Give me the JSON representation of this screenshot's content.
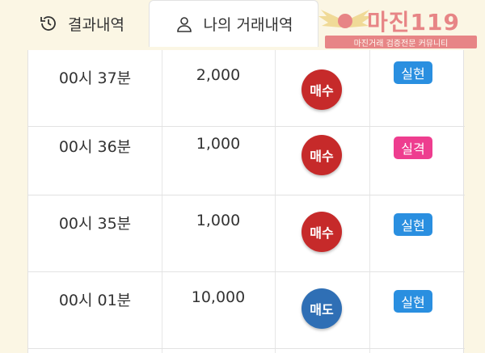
{
  "tabs": [
    {
      "label": "결과내역",
      "icon": "history-icon"
    },
    {
      "label": "나의 거래내역",
      "icon": "user-icon"
    }
  ],
  "watermark": {
    "title": "마진119",
    "subtitle": "마진거래 검증전문 커뮤니티"
  },
  "colors": {
    "buy": "#c62a2a",
    "sell": "#2f6fb5",
    "realized": "#2a8fe0",
    "failed": "#ee3d8f"
  },
  "trades": [
    {
      "time": "00시 37분",
      "amount": "2,000",
      "side": "매수",
      "side_type": "buy",
      "result": "실현",
      "result_type": "realized"
    },
    {
      "time": "00시 36분",
      "amount": "1,000",
      "side": "매수",
      "side_type": "buy",
      "result": "실격",
      "result_type": "failed"
    },
    {
      "time": "00시 35분",
      "amount": "1,000",
      "side": "매수",
      "side_type": "buy",
      "result": "실현",
      "result_type": "realized"
    },
    {
      "time": "00시 01분",
      "amount": "10,000",
      "side": "매도",
      "side_type": "sell",
      "result": "실현",
      "result_type": "realized"
    }
  ]
}
